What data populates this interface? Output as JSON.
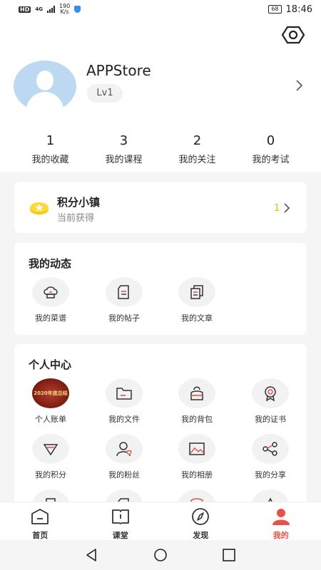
{
  "status_bar": {
    "hd": "HD",
    "network": "4G",
    "speed_value": "190",
    "speed_unit": "K/s",
    "battery": "68",
    "time": "18:46"
  },
  "profile": {
    "username": "APPStore",
    "level": "Lv1",
    "stats": [
      {
        "value": "1",
        "label": "我的收藏"
      },
      {
        "value": "3",
        "label": "我的课程"
      },
      {
        "value": "2",
        "label": "我的关注"
      },
      {
        "value": "0",
        "label": "我的考试"
      }
    ]
  },
  "points": {
    "title": "积分小镇",
    "subtitle": "当前获得",
    "count": "1"
  },
  "activity": {
    "title": "我的动态",
    "items": [
      {
        "label": "我的菜谱",
        "icon": "chef-hat-icon"
      },
      {
        "label": "我的帖子",
        "icon": "post-icon"
      },
      {
        "label": "我的文章",
        "icon": "article-icon"
      }
    ]
  },
  "center": {
    "title": "个人中心",
    "bill_badge": "2020年度总结",
    "items": [
      {
        "label": "个人账单",
        "icon": "bill-icon"
      },
      {
        "label": "我的文件",
        "icon": "folder-icon"
      },
      {
        "label": "我的背包",
        "icon": "backpack-icon"
      },
      {
        "label": "我的证书",
        "icon": "certificate-icon"
      },
      {
        "label": "我的积分",
        "icon": "diamond-icon"
      },
      {
        "label": "我的粉丝",
        "icon": "fans-icon"
      },
      {
        "label": "我的相册",
        "icon": "album-icon"
      },
      {
        "label": "我的分享",
        "icon": "share-icon"
      }
    ]
  },
  "tabbar": {
    "tabs": [
      {
        "label": "首页",
        "icon": "home-icon"
      },
      {
        "label": "课堂",
        "icon": "book-icon"
      },
      {
        "label": "发现",
        "icon": "compass-icon"
      },
      {
        "label": "我的",
        "icon": "person-icon"
      }
    ],
    "active_color": "#e8504a"
  }
}
